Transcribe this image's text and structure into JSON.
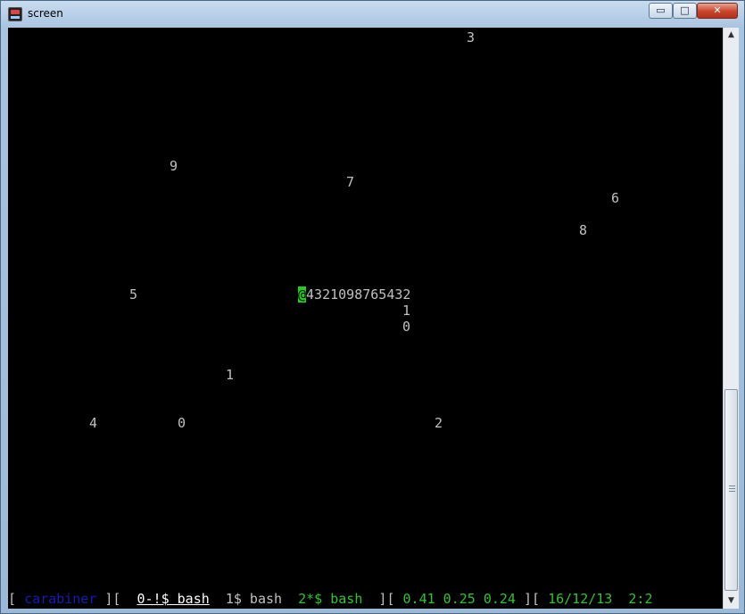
{
  "window": {
    "title": "screen",
    "icon": "terminal-app-icon",
    "controls": {
      "minimize": "▭",
      "maximize": "□",
      "close": "✕"
    }
  },
  "terminal": {
    "scattered_digits": [
      {
        "text": "3",
        "row": 0,
        "col": 57
      },
      {
        "text": "9",
        "row": 8,
        "col": 20
      },
      {
        "text": "7",
        "row": 9,
        "col": 42
      },
      {
        "text": "6",
        "row": 10,
        "col": 75
      },
      {
        "text": "8",
        "row": 12,
        "col": 71
      },
      {
        "text": "5",
        "row": 16,
        "col": 15
      },
      {
        "text": "1",
        "row": 17,
        "col": 49
      },
      {
        "text": "0",
        "row": 18,
        "col": 49
      },
      {
        "text": "1",
        "row": 21,
        "col": 27
      },
      {
        "text": "4",
        "row": 24,
        "col": 10
      },
      {
        "text": "0",
        "row": 24,
        "col": 21
      },
      {
        "text": "2",
        "row": 24,
        "col": 53
      }
    ],
    "snake": {
      "head": "@",
      "body": "4321098765432",
      "row": 16,
      "col": 36
    }
  },
  "status_bar": {
    "open_bracket": "[ ",
    "hostname": "carabiner",
    "sep1": " ][  ",
    "window0": "0-!$ bash",
    "gap1": "  ",
    "window1": "1$ bash",
    "gap2": "  ",
    "window2": "2*$ bash",
    "sep2": "  ][ ",
    "load": "0.41 0.25 0.24",
    "sep3": " ][ ",
    "date": "16/12/13",
    "gap3": "  ",
    "time": "2:2"
  },
  "colors": {
    "terminal_bg": "#000000",
    "text": "#c0c0c0",
    "cursor": "#1fcf1f",
    "hostname": "#1a1ab8",
    "status_green": "#2ec42e"
  },
  "scrollbar": {
    "up_icon": "▲",
    "down_icon": "▼"
  }
}
